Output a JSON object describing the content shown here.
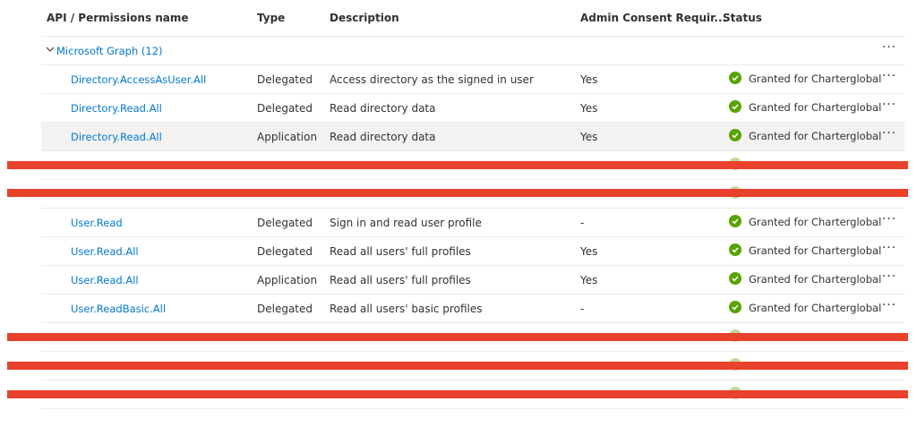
{
  "header": {
    "name": "API / Permissions name",
    "type": "Type",
    "description": "Description",
    "admin": "Admin Consent Requir...",
    "status": "Status"
  },
  "group": {
    "label": "Microsoft Graph (12)",
    "more": "···"
  },
  "rows": [
    {
      "name": "Directory.AccessAsUser.All",
      "type": "Delegated",
      "description": "Access directory as the signed in user",
      "admin": "Yes",
      "status": "Granted for Charterglobal",
      "more": "···"
    },
    {
      "name": "Directory.Read.All",
      "type": "Delegated",
      "description": "Read directory data",
      "admin": "Yes",
      "status": "Granted for Charterglobal",
      "more": "···"
    },
    {
      "name": "Directory.Read.All",
      "type": "Application",
      "description": "Read directory data",
      "admin": "Yes",
      "status": "Granted for Charterglobal",
      "more": "···"
    },
    {
      "name": "",
      "type": "",
      "description": "",
      "admin": "",
      "status": "",
      "more": ""
    },
    {
      "name": "",
      "type": "",
      "description": "",
      "admin": "",
      "status": "",
      "more": ""
    },
    {
      "name": "User.Read",
      "type": "Delegated",
      "description": "Sign in and read user profile",
      "admin": "-",
      "status": "Granted for Charterglobal",
      "more": "···"
    },
    {
      "name": "User.Read.All",
      "type": "Delegated",
      "description": "Read all users' full profiles",
      "admin": "Yes",
      "status": "Granted for Charterglobal",
      "more": "···"
    },
    {
      "name": "User.Read.All",
      "type": "Application",
      "description": "Read all users' full profiles",
      "admin": "Yes",
      "status": "Granted for Charterglobal",
      "more": "···"
    },
    {
      "name": "User.ReadBasic.All",
      "type": "Delegated",
      "description": "Read all users' basic profiles",
      "admin": "-",
      "status": "Granted for Charterglobal",
      "more": "···"
    },
    {
      "name": "",
      "type": "",
      "description": "",
      "admin": "",
      "status": "",
      "more": ""
    },
    {
      "name": "",
      "type": "",
      "description": "",
      "admin": "",
      "status": "",
      "more": ""
    },
    {
      "name": "",
      "type": "",
      "description": "",
      "admin": "",
      "status": "",
      "more": ""
    }
  ],
  "icons": {
    "status": "checkmark-circle-icon",
    "group": "chevron-down-icon",
    "more": "more-icon"
  },
  "colors": {
    "link": "#0078d4",
    "granted": "#57a300",
    "redaction": "#e8412c",
    "selected_row": "#f3f2f1"
  }
}
